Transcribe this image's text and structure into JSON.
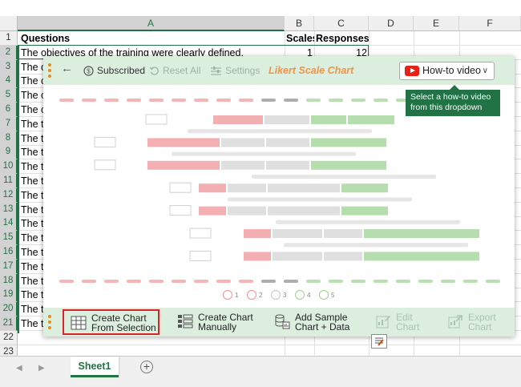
{
  "sheet": {
    "columns": [
      "A",
      "B",
      "C",
      "D",
      "E",
      "F"
    ],
    "selected_columns": [
      "A"
    ],
    "rows": [
      {
        "num": "1",
        "a": "Questions",
        "b": "Scales",
        "c": "Responses",
        "bold": true
      },
      {
        "num": "2",
        "a": "The objectives of the training were clearly defined.",
        "b": "1",
        "c": "12"
      },
      {
        "num": "3",
        "a": "The o",
        "b": "",
        "c": ""
      },
      {
        "num": "4",
        "a": "The o",
        "b": "",
        "c": ""
      },
      {
        "num": "5",
        "a": "The o",
        "b": "",
        "c": ""
      },
      {
        "num": "6",
        "a": "The o",
        "b": "",
        "c": ""
      },
      {
        "num": "7",
        "a": "The tr",
        "b": "",
        "c": ""
      },
      {
        "num": "8",
        "a": "The tr",
        "b": "",
        "c": ""
      },
      {
        "num": "9",
        "a": "The tr",
        "b": "",
        "c": ""
      },
      {
        "num": "10",
        "a": "The tr",
        "b": "",
        "c": ""
      },
      {
        "num": "11",
        "a": "The tr",
        "b": "",
        "c": ""
      },
      {
        "num": "12",
        "a": "The tr",
        "b": "",
        "c": ""
      },
      {
        "num": "13",
        "a": "The tr",
        "b": "",
        "c": ""
      },
      {
        "num": "14",
        "a": "The tr",
        "b": "",
        "c": ""
      },
      {
        "num": "15",
        "a": "The tr",
        "b": "",
        "c": ""
      },
      {
        "num": "16",
        "a": "The tr",
        "b": "",
        "c": ""
      },
      {
        "num": "17",
        "a": "The tr",
        "b": "",
        "c": ""
      },
      {
        "num": "18",
        "a": "The tr",
        "b": "",
        "c": ""
      },
      {
        "num": "19",
        "a": "The tr",
        "b": "",
        "c": ""
      },
      {
        "num": "20",
        "a": "The tr",
        "b": "",
        "c": ""
      },
      {
        "num": "21",
        "a": "The tr",
        "b": "",
        "c": ""
      },
      {
        "num": "22",
        "a": "",
        "b": "",
        "c": ""
      },
      {
        "num": "23",
        "a": "",
        "b": "",
        "c": ""
      }
    ],
    "tab_name": "Sheet1",
    "add_sheet_symbol": "+",
    "accent": "#217346"
  },
  "panel": {
    "back_icon": "back-arrow-icon",
    "subscribed_label": "Subscribed",
    "reset_label": "Reset All",
    "settings_label": "Settings",
    "title": "Likert Scale Chart",
    "howto_label": "How-to video",
    "tooltip_line1": "Select a how-to video",
    "tooltip_line2": "from this dropdown",
    "legend_numbers": [
      "1",
      "2",
      "3",
      "4",
      "5"
    ],
    "buttons": {
      "selection_line1": "Create Chart",
      "selection_line2": "From Selection",
      "manual_line1": "Create Chart",
      "manual_line2": "Manually",
      "sample_line1": "Add Sample",
      "sample_line2": "Chart + Data",
      "edit_line1": "Edit",
      "edit_line2": "Chart",
      "export_line1": "Export",
      "export_line2": "Chart"
    },
    "colors": {
      "toolbar_bg": "#dcefdf",
      "title": "#f0944b",
      "negative": "#f2a1a4",
      "neutral": "#d9d9d9",
      "positive": "#a9d79f"
    }
  }
}
